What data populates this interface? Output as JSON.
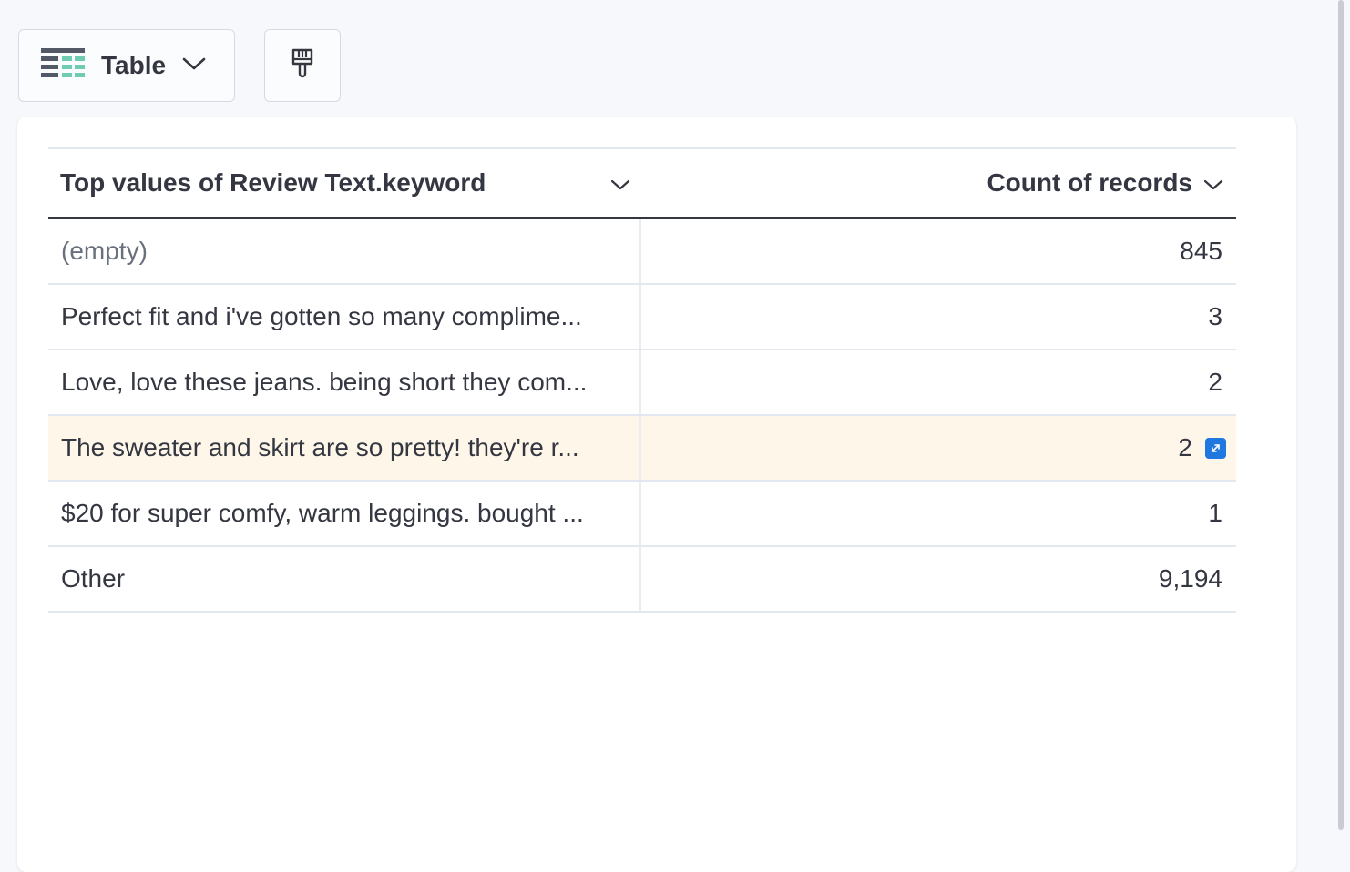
{
  "toolbar": {
    "viz_label": "Table",
    "viz_icon": "table-icon",
    "style_icon": "paintbrush-icon"
  },
  "table": {
    "columns": [
      {
        "label": "Top values of Review Text.keyword",
        "icon": "chevron-down-icon"
      },
      {
        "label": "Count of records",
        "icon": "chevron-down-icon"
      }
    ],
    "rows": [
      {
        "value": "(empty)",
        "count": "845"
      },
      {
        "value": "Perfect fit and i've gotten so many complime...",
        "count": "3"
      },
      {
        "value": "Love, love these jeans. being short they com...",
        "count": "2"
      },
      {
        "value": "The sweater and skirt are so pretty! they're r...",
        "count": "2"
      },
      {
        "value": "$20 for super comfy, warm leggings. bought ...",
        "count": "1"
      },
      {
        "value": "Other",
        "count": "9,194"
      }
    ],
    "highlighted_row": 3,
    "expand_icon": "expand-icon"
  },
  "colors": {
    "accent": "#1f77e0",
    "highlight_row": "#fef7e9",
    "text": "#343741",
    "muted_text": "#69707d"
  }
}
